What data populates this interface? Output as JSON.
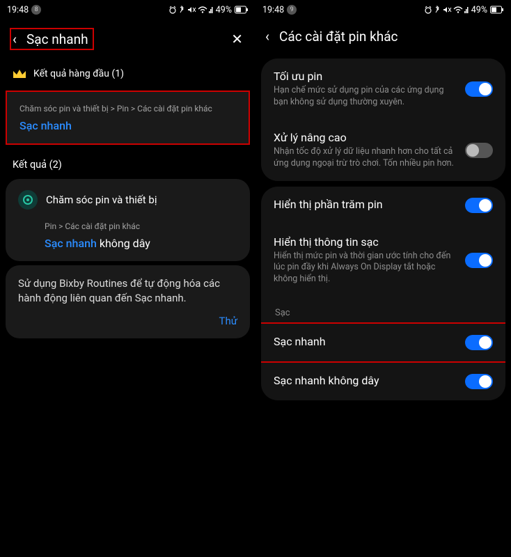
{
  "left": {
    "status": {
      "time": "19:48",
      "notif": "8",
      "battery": "49%"
    },
    "header": {
      "title": "Sạc nhanh"
    },
    "top_result_label": "Kết quả hàng đầu (1)",
    "top_result": {
      "breadcrumb": "Chăm sóc pin và thiết bị > Pin > Các cài đặt pin khác",
      "link": "Sạc nhanh"
    },
    "results_label": "Kết quả (2)",
    "result1": {
      "app": "Chăm sóc pin và thiết bị",
      "breadcrumb": "Pin > Các cài đặt pin khác",
      "link": "Sạc nhanh",
      "suffix": " không dây"
    },
    "bixby": {
      "text": "Sử dụng Bixby Routines để tự động hóa các hành động liên quan đến Sạc nhanh.",
      "try": "Thử"
    }
  },
  "right": {
    "status": {
      "time": "19:48",
      "notif": "9",
      "battery": "49%"
    },
    "header": {
      "title": "Các cài đặt pin khác"
    },
    "item1": {
      "title": "Tối ưu pin",
      "desc": "Hạn chế mức sử dụng pin của các ứng dụng bạn không sử dụng thường xuyên."
    },
    "item2": {
      "title": "Xử lý nâng cao",
      "desc": "Nhận tốc độ xử lý dữ liệu nhanh hơn cho tất cả ứng dụng ngoại trừ trò chơi. Tốn nhiều pin hơn."
    },
    "item3": {
      "title": "Hiển thị phần trăm pin"
    },
    "item4": {
      "title": "Hiển thị thông tin sạc",
      "desc": "Hiển thị mức pin và thời gian ước tính cho đến lúc pin đầy khi Always On Display tắt hoặc không hiển thị."
    },
    "group_label": "Sạc",
    "item5": {
      "title": "Sạc nhanh"
    },
    "item6": {
      "title": "Sạc nhanh không dây"
    }
  }
}
